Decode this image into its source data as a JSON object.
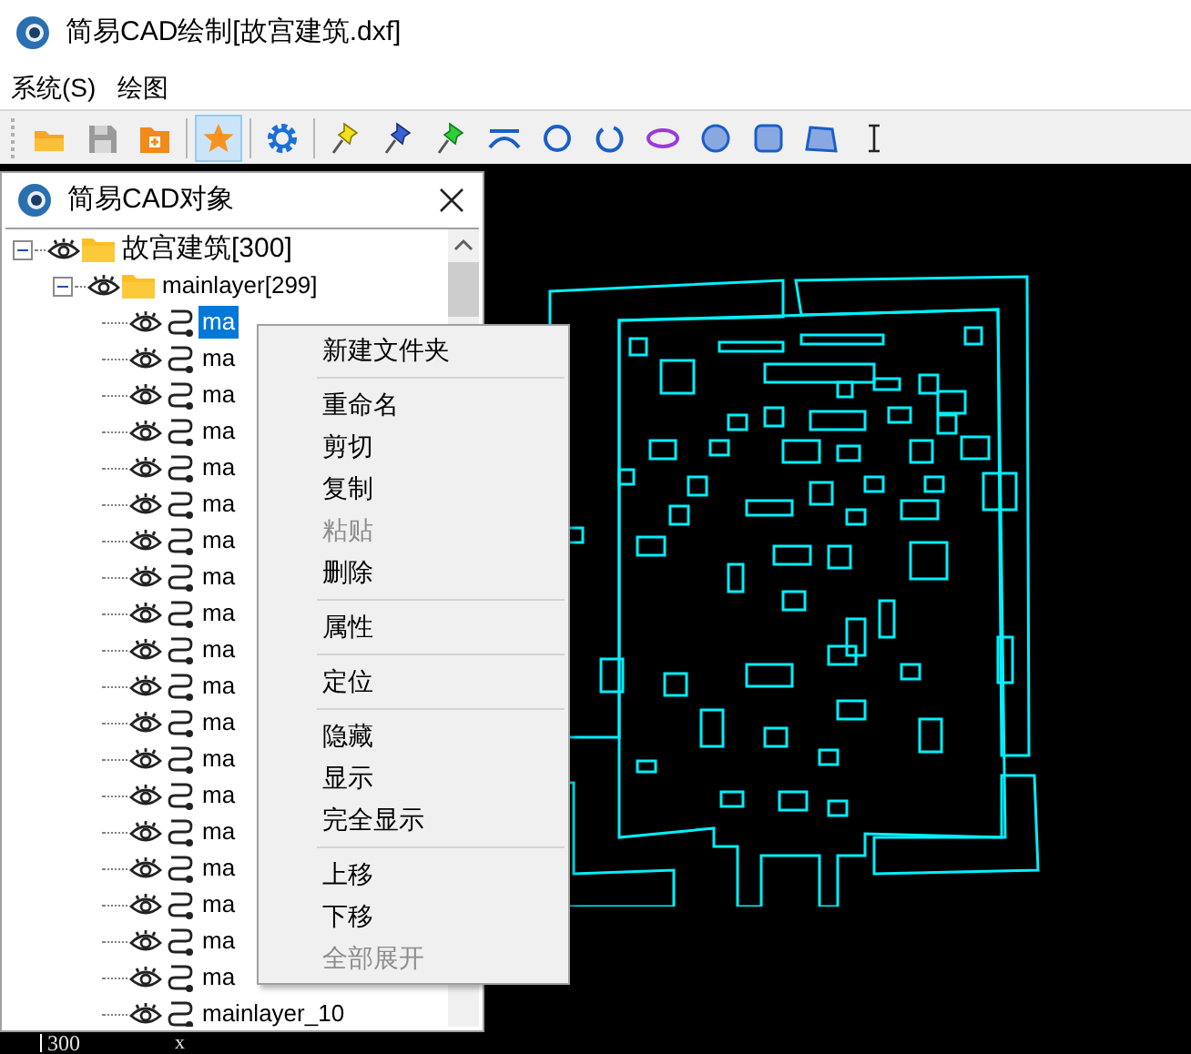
{
  "window": {
    "title": "简易CAD绘制[故宫建筑.dxf]"
  },
  "menu_bar": [
    "系统(S)",
    "绘图"
  ],
  "toolbar": [
    {
      "selected": false
    },
    {
      "selected": false
    },
    {
      "selected": false
    },
    {
      "selected": true
    },
    {
      "selected": false
    },
    {
      "selected": false
    },
    {
      "selected": false
    },
    {
      "selected": false
    },
    {
      "selected": false
    },
    {
      "selected": false
    },
    {
      "selected": false
    },
    {
      "selected": false
    },
    {
      "selected": false
    },
    {
      "selected": false
    },
    {
      "selected": false
    },
    {
      "selected": false
    }
  ],
  "object_panel": {
    "title": "简易CAD对象",
    "tree": [
      {
        "label": "故宫建筑[300]",
        "expanded": true,
        "selected": false,
        "children": [
          {
            "label": "mainlayer[299]",
            "expanded": true,
            "selected": false,
            "children": [
              {
                "label": "ma",
                "selected": true
              },
              {
                "label": "ma",
                "selected": false
              },
              {
                "label": "ma",
                "selected": false
              },
              {
                "label": "ma",
                "selected": false
              },
              {
                "label": "ma",
                "selected": false
              },
              {
                "label": "ma",
                "selected": false
              },
              {
                "label": "ma",
                "selected": false
              },
              {
                "label": "ma",
                "selected": false
              },
              {
                "label": "ma",
                "selected": false
              },
              {
                "label": "ma",
                "selected": false
              },
              {
                "label": "ma",
                "selected": false
              },
              {
                "label": "ma",
                "selected": false
              },
              {
                "label": "ma",
                "selected": false
              },
              {
                "label": "ma",
                "selected": false
              },
              {
                "label": "ma",
                "selected": false
              },
              {
                "label": "ma",
                "selected": false
              },
              {
                "label": "ma",
                "selected": false
              },
              {
                "label": "ma",
                "selected": false
              },
              {
                "label": "ma",
                "selected": false
              },
              {
                "label": "mainlayer_10",
                "selected": false
              }
            ]
          }
        ]
      }
    ]
  },
  "context_menu": [
    [
      {
        "label": "新建文件夹",
        "disabled": false
      }
    ],
    [
      {
        "label": "重命名",
        "disabled": false
      },
      {
        "label": "剪切",
        "disabled": false
      },
      {
        "label": "复制",
        "disabled": false
      },
      {
        "label": "粘贴",
        "disabled": true
      },
      {
        "label": "删除",
        "disabled": false
      }
    ],
    [
      {
        "label": "属性",
        "disabled": false
      }
    ],
    [
      {
        "label": "定位",
        "disabled": false
      }
    ],
    [
      {
        "label": "隐藏",
        "disabled": false
      },
      {
        "label": "显示",
        "disabled": false
      },
      {
        "label": "完全显示",
        "disabled": false
      }
    ],
    [
      {
        "label": "上移",
        "disabled": false
      },
      {
        "label": "下移",
        "disabled": false
      },
      {
        "label": "全部展开",
        "disabled": true
      }
    ]
  ],
  "canvas": {
    "axis_value": "300",
    "axis_label": "x"
  }
}
